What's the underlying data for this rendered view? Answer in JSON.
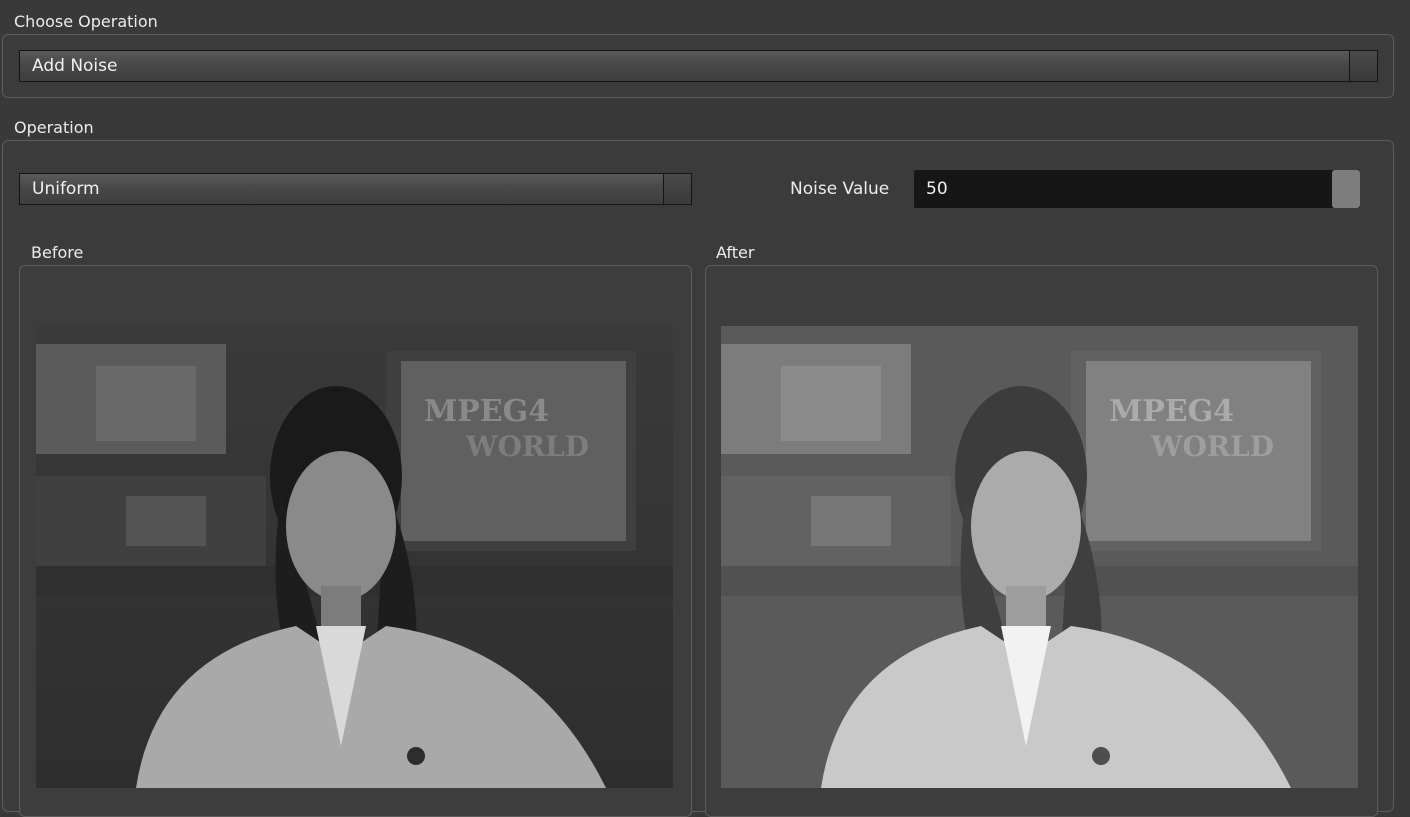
{
  "choose_operation": {
    "label": "Choose Operation",
    "selected": "Add Noise"
  },
  "operation": {
    "label": "Operation",
    "noise_type": "Uniform",
    "noise_value_label": "Noise Value",
    "noise_value": "50",
    "noise_value_fraction": 1.0
  },
  "before": {
    "label": "Before"
  },
  "after": {
    "label": "After"
  },
  "colors": {
    "background": "#393939",
    "panel_border": "#5d5d5d",
    "slider_track": "#161616",
    "slider_thumb": "#7d7d7d"
  }
}
